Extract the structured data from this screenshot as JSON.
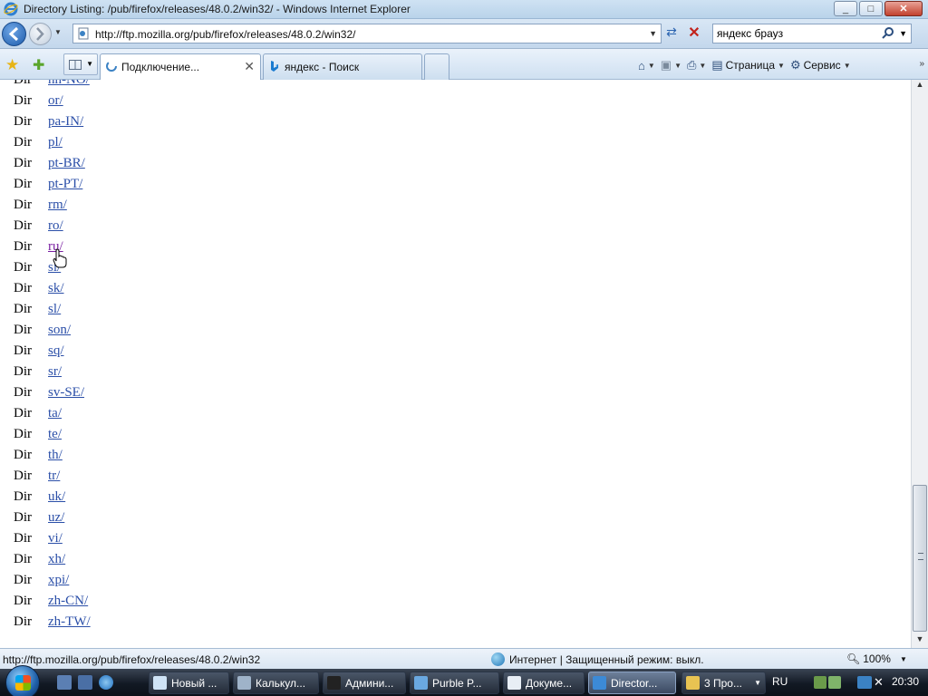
{
  "window": {
    "title": "Directory Listing: /pub/firefox/releases/48.0.2/win32/ - Windows Internet Explorer",
    "minimize_label": "_",
    "maximize_label": "□",
    "close_label": "✕"
  },
  "address": {
    "url": "http://ftp.mozilla.org/pub/firefox/releases/48.0.2/win32/"
  },
  "search": {
    "value": "яндекс брауз"
  },
  "tabs": [
    {
      "label": "Подключение...",
      "active": true,
      "close_label": "✕"
    },
    {
      "label": "яндекс - Поиск",
      "active": false
    }
  ],
  "commandbar": {
    "page_label": "Страница",
    "tools_label": "Сервис"
  },
  "listing": {
    "rows": [
      {
        "kind": "Dir",
        "name": "nn-NO/"
      },
      {
        "kind": "Dir",
        "name": "or/"
      },
      {
        "kind": "Dir",
        "name": "pa-IN/"
      },
      {
        "kind": "Dir",
        "name": "pl/"
      },
      {
        "kind": "Dir",
        "name": "pt-BR/"
      },
      {
        "kind": "Dir",
        "name": "pt-PT/"
      },
      {
        "kind": "Dir",
        "name": "rm/"
      },
      {
        "kind": "Dir",
        "name": "ro/"
      },
      {
        "kind": "Dir",
        "name": "ru/",
        "visited": true
      },
      {
        "kind": "Dir",
        "name": "si/"
      },
      {
        "kind": "Dir",
        "name": "sk/"
      },
      {
        "kind": "Dir",
        "name": "sl/"
      },
      {
        "kind": "Dir",
        "name": "son/"
      },
      {
        "kind": "Dir",
        "name": "sq/"
      },
      {
        "kind": "Dir",
        "name": "sr/"
      },
      {
        "kind": "Dir",
        "name": "sv-SE/"
      },
      {
        "kind": "Dir",
        "name": "ta/"
      },
      {
        "kind": "Dir",
        "name": "te/"
      },
      {
        "kind": "Dir",
        "name": "th/"
      },
      {
        "kind": "Dir",
        "name": "tr/"
      },
      {
        "kind": "Dir",
        "name": "uk/"
      },
      {
        "kind": "Dir",
        "name": "uz/"
      },
      {
        "kind": "Dir",
        "name": "vi/"
      },
      {
        "kind": "Dir",
        "name": "xh/"
      },
      {
        "kind": "Dir",
        "name": "xpi/"
      },
      {
        "kind": "Dir",
        "name": "zh-CN/"
      },
      {
        "kind": "Dir",
        "name": "zh-TW/"
      }
    ]
  },
  "statusbar": {
    "url": "http://ftp.mozilla.org/pub/firefox/releases/48.0.2/win32",
    "zone": "Интернет | Защищенный режим: выкл.",
    "zoom": "100%"
  },
  "taskbar": {
    "buttons": [
      {
        "label": "Новый ...",
        "icon": "notepad-icon"
      },
      {
        "label": "Калькул...",
        "icon": "calculator-icon"
      },
      {
        "label": "Админи...",
        "icon": "cmd-icon"
      },
      {
        "label": "Purble P...",
        "icon": "game-icon"
      },
      {
        "label": "Докуме...",
        "icon": "document-icon"
      },
      {
        "label": "Director...",
        "icon": "ie-icon",
        "active": true
      },
      {
        "label": "3 Про...",
        "icon": "folder-icon"
      }
    ],
    "language": "RU",
    "clock": "20:30"
  },
  "colors": {
    "link": "#2b4fa8",
    "visited_link": "#7a1fa2"
  }
}
